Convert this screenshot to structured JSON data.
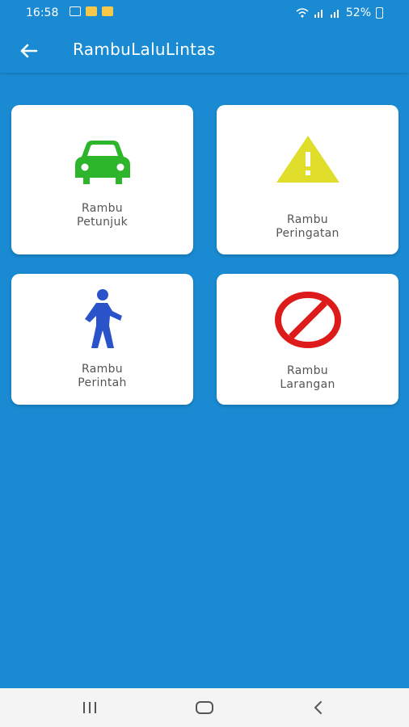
{
  "status_bar": {
    "time": "16:58",
    "battery": "52%"
  },
  "app_bar": {
    "title": "RambuLaluLintas",
    "back_icon": "arrow-left-icon"
  },
  "cards": [
    {
      "line1": "Rambu",
      "line2": "Petunjuk",
      "icon": "car-icon",
      "color": "#2db52b"
    },
    {
      "line1": "Rambu",
      "line2": "Peringatan",
      "icon": "warning-icon",
      "color": "#e0de2a"
    },
    {
      "line1": "Rambu",
      "line2": "Perintah",
      "icon": "pedestrian-icon",
      "color": "#2a53c9"
    },
    {
      "line1": "Rambu",
      "line2": "Larangan",
      "icon": "prohibition-icon",
      "color": "#dd1b1b"
    }
  ],
  "nav_bar": {
    "recents_icon": "recents-icon",
    "home_icon": "home-icon",
    "back_icon": "back-chevron-icon"
  },
  "colors": {
    "background": "#1a8bd3",
    "card": "#ffffff",
    "label": "#555555"
  }
}
